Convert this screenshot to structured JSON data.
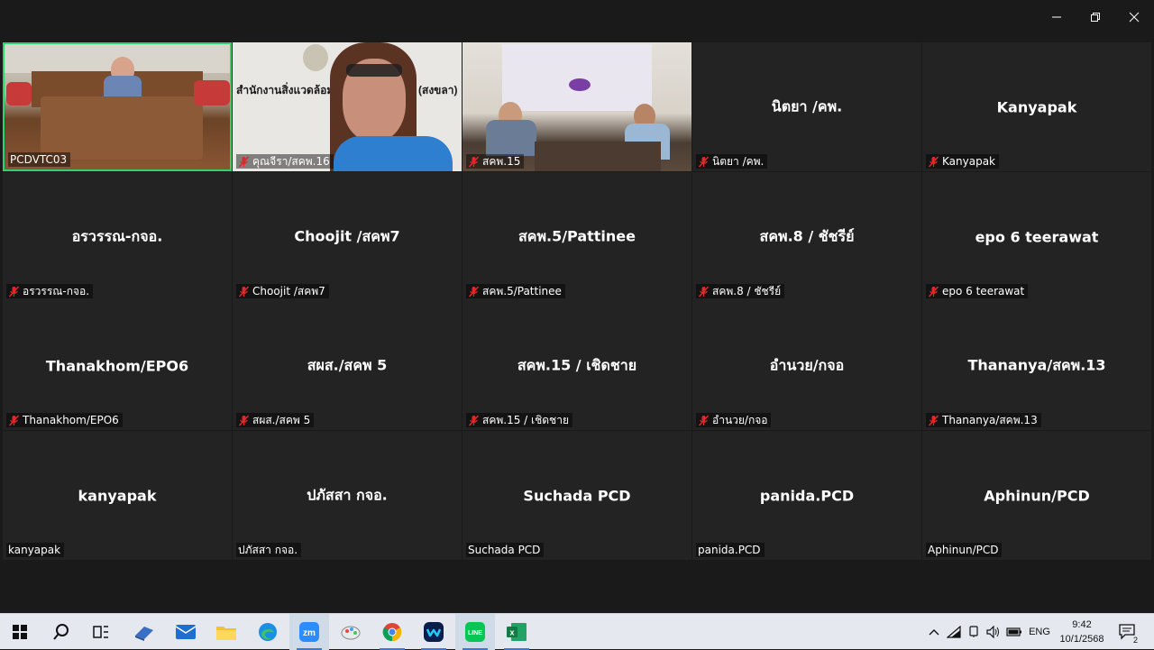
{
  "window": {
    "minimize_icon": "minimize-icon",
    "restore_icon": "restore-icon",
    "close_icon": "close-icon"
  },
  "tiles": [
    {
      "tag": "PCDVTC03",
      "big": "",
      "video": true,
      "muted": false,
      "active": true
    },
    {
      "tag": "คุณจีรา/สคพ.16",
      "big": "",
      "video": true,
      "muted": true,
      "active": false,
      "overlay_text": "สำนักงานสิ่งแวดล้อมแ",
      "overlay_text2": "(สงขลา)"
    },
    {
      "tag": "สคพ.15",
      "big": "",
      "video": true,
      "muted": true,
      "active": false
    },
    {
      "tag": "นิตยา /คพ.",
      "big": "นิตยา /คพ.",
      "video": false,
      "muted": true
    },
    {
      "tag": "Kanyapak",
      "big": "Kanyapak",
      "video": false,
      "muted": true
    },
    {
      "tag": "อรวรรณ-กจอ.",
      "big": "อรวรรณ-กจอ.",
      "video": false,
      "muted": true
    },
    {
      "tag": "Choojit /สคพ7",
      "big": "Choojit /สคพ7",
      "video": false,
      "muted": true
    },
    {
      "tag": "สคพ.5/Pattinee",
      "big": "สคพ.5/Pattinee",
      "video": false,
      "muted": true
    },
    {
      "tag": "สคพ.8 / ชัชรีย์",
      "big": "สคพ.8 / ชัชรีย์",
      "video": false,
      "muted": true
    },
    {
      "tag": "epo 6 teerawat",
      "big": "epo 6 teerawat",
      "video": false,
      "muted": true
    },
    {
      "tag": "Thanakhom/EPO6",
      "big": "Thanakhom/EPO6",
      "video": false,
      "muted": true
    },
    {
      "tag": "สผส./สคพ 5",
      "big": "สผส./สคพ 5",
      "video": false,
      "muted": true
    },
    {
      "tag": "สคพ.15 / เชิดชาย",
      "big": "สคพ.15 / เชิดชาย",
      "video": false,
      "muted": true
    },
    {
      "tag": "อำนวย/กจอ",
      "big": "อำนวย/กจอ",
      "video": false,
      "muted": true
    },
    {
      "tag": "Thananya/สคพ.13",
      "big": "Thananya/สคพ.13",
      "video": false,
      "muted": true
    },
    {
      "tag": "kanyapak",
      "big": "kanyapak",
      "video": false,
      "muted": false
    },
    {
      "tag": "ปภัสสา กจอ.",
      "big": "ปภัสสา กจอ.",
      "video": false,
      "muted": false
    },
    {
      "tag": "Suchada PCD",
      "big": "Suchada PCD",
      "video": false,
      "muted": false
    },
    {
      "tag": "panida.PCD",
      "big": "panida.PCD",
      "video": false,
      "muted": false
    },
    {
      "tag": "Aphinun/PCD",
      "big": "Aphinun/PCD",
      "video": false,
      "muted": false
    }
  ],
  "taskbar": {
    "apps": [
      {
        "name": "start-icon",
        "running": false
      },
      {
        "name": "search-icon",
        "running": false
      },
      {
        "name": "task-view-icon",
        "running": false
      },
      {
        "name": "meeting-app-icon",
        "running": false
      },
      {
        "name": "mail-icon",
        "running": false
      },
      {
        "name": "file-explorer-icon",
        "running": false
      },
      {
        "name": "edge-icon",
        "running": false
      },
      {
        "name": "zoom-icon",
        "running": true,
        "active": true,
        "label": "zm"
      },
      {
        "name": "paint-icon",
        "running": false
      },
      {
        "name": "chrome-icon",
        "running": true
      },
      {
        "name": "webex-icon",
        "running": true
      },
      {
        "name": "line-icon",
        "running": true,
        "label": "LINE"
      },
      {
        "name": "excel-icon",
        "running": true,
        "label": "x"
      }
    ],
    "language": "ENG",
    "time": "9:42",
    "date": "10/1/2568",
    "notification_count": "2"
  },
  "colors": {
    "active_border": "#2dd36f",
    "tile_bg": "#232323",
    "muted_red": "#e02828"
  }
}
